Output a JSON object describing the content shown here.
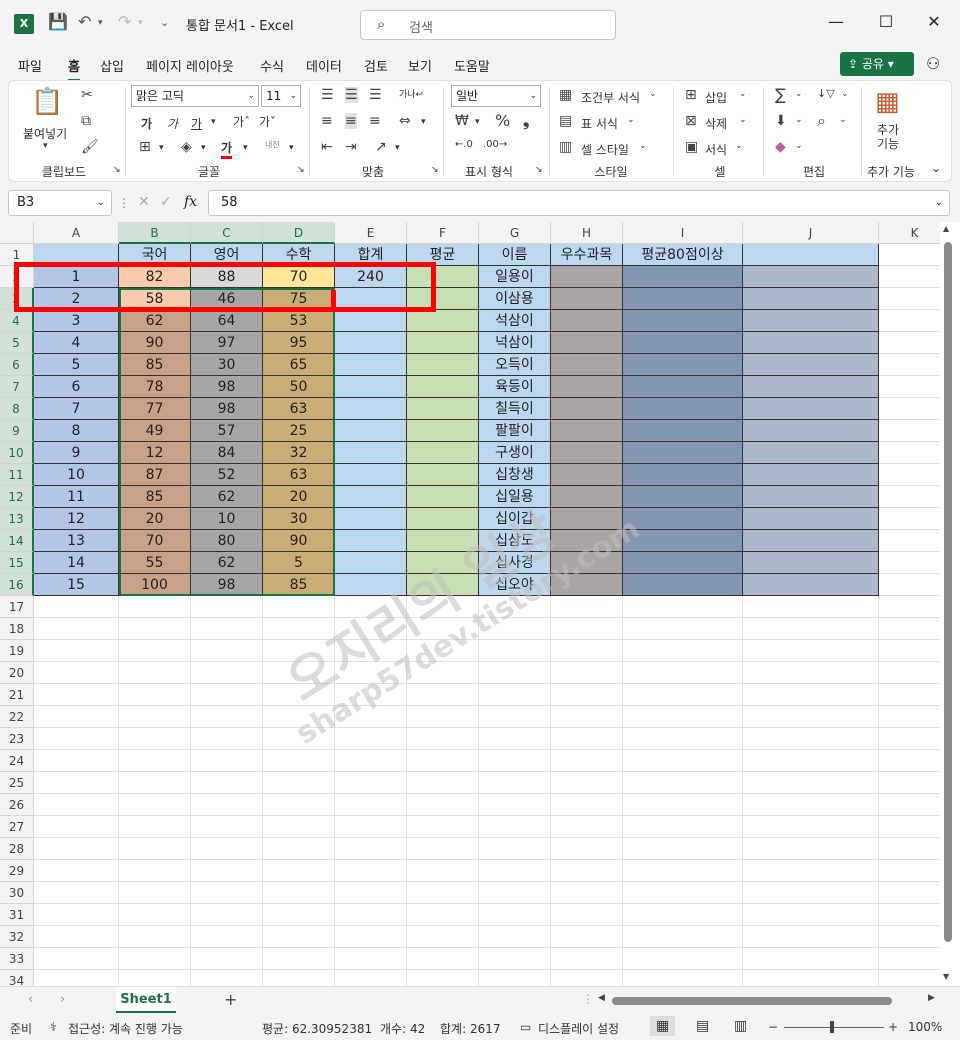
{
  "title": "통합 문서1  -  Excel",
  "search_placeholder": "검색",
  "menu": [
    "파일",
    "홈",
    "삽입",
    "페이지 레이아웃",
    "수식",
    "데이터",
    "검토",
    "보기",
    "도움말"
  ],
  "share_label": "공유",
  "ribbon": {
    "paste": "붙여넣기",
    "font_name": "맑은 고딕",
    "font_size": "11",
    "number_format": "일반",
    "conditional": "조건부 서식",
    "table_format": "표 서식",
    "cell_style": "셀 스타일",
    "insert": "삽입",
    "delete": "삭제",
    "format": "서식",
    "addins": "추가\n기능",
    "groups": [
      "클립보드",
      "글꼴",
      "맞춤",
      "표시 형식",
      "스타일",
      "셀",
      "편집",
      "추가 기능"
    ]
  },
  "namebox": "B3",
  "formula_value": "58",
  "columns": [
    "A",
    "B",
    "C",
    "D",
    "E",
    "F",
    "G",
    "H",
    "I",
    "J",
    "K"
  ],
  "header_row": [
    "",
    "국어",
    "영어",
    "수학",
    "합계",
    "평균",
    "이름",
    "우수과목",
    "평균80점이상",
    ""
  ],
  "rows": [
    [
      "1",
      "82",
      "88",
      "70",
      "240",
      "",
      "일용이",
      "",
      "",
      ""
    ],
    [
      "2",
      "58",
      "46",
      "75",
      "",
      "",
      "이삼용",
      "",
      "",
      ""
    ],
    [
      "3",
      "62",
      "64",
      "53",
      "",
      "",
      "석삼이",
      "",
      "",
      ""
    ],
    [
      "4",
      "90",
      "97",
      "95",
      "",
      "",
      "넉삼이",
      "",
      "",
      ""
    ],
    [
      "5",
      "85",
      "30",
      "65",
      "",
      "",
      "오득이",
      "",
      "",
      ""
    ],
    [
      "6",
      "78",
      "98",
      "50",
      "",
      "",
      "육등이",
      "",
      "",
      ""
    ],
    [
      "7",
      "77",
      "98",
      "63",
      "",
      "",
      "칠득이",
      "",
      "",
      ""
    ],
    [
      "8",
      "49",
      "57",
      "25",
      "",
      "",
      "팔팔이",
      "",
      "",
      ""
    ],
    [
      "9",
      "12",
      "84",
      "32",
      "",
      "",
      "구생이",
      "",
      "",
      ""
    ],
    [
      "10",
      "87",
      "52",
      "63",
      "",
      "",
      "십창생",
      "",
      "",
      ""
    ],
    [
      "11",
      "85",
      "62",
      "20",
      "",
      "",
      "십일용",
      "",
      "",
      ""
    ],
    [
      "12",
      "20",
      "10",
      "30",
      "",
      "",
      "십이갑",
      "",
      "",
      ""
    ],
    [
      "13",
      "70",
      "80",
      "90",
      "",
      "",
      "십삼도",
      "",
      "",
      ""
    ],
    [
      "14",
      "55",
      "62",
      "5",
      "",
      "",
      "십사경",
      "",
      "",
      ""
    ],
    [
      "15",
      "100",
      "98",
      "85",
      "",
      "",
      "십오야",
      "",
      "",
      ""
    ]
  ],
  "row_numbers": [
    "1",
    "2",
    "3",
    "4",
    "5",
    "6",
    "7",
    "8",
    "9",
    "10",
    "11",
    "12",
    "13",
    "14",
    "15",
    "16",
    "17",
    "18",
    "19",
    "20",
    "21",
    "22",
    "23",
    "24",
    "25",
    "26",
    "27",
    "28",
    "29",
    "30",
    "31",
    "32",
    "33",
    "34"
  ],
  "watermark": [
    "오지리의 일상",
    "sharp57dev.tistory.com"
  ],
  "sheet_tab": "Sheet1",
  "status": {
    "ready": "준비",
    "accessibility": "접근성: 계속 진행 가능",
    "average": "평균: 62.30952381",
    "count": "개수: 42",
    "sum": "합계: 2617",
    "display": "디스플레이 설정",
    "zoom": "100%"
  },
  "colors": {
    "accent": "#1e7145",
    "col_a": "#b4c6e7",
    "col_b": "#c9a08a",
    "col_c": "#a6a6a6",
    "col_d": "#c9ad74",
    "col_e": "#bdd7ee",
    "col_f": "#c6e0b4",
    "col_g": "#bdd7ee",
    "col_h": "#aba4a4",
    "col_i": "#8497b0",
    "col_j": "#acb9ca",
    "red_box": "#ff0000"
  }
}
